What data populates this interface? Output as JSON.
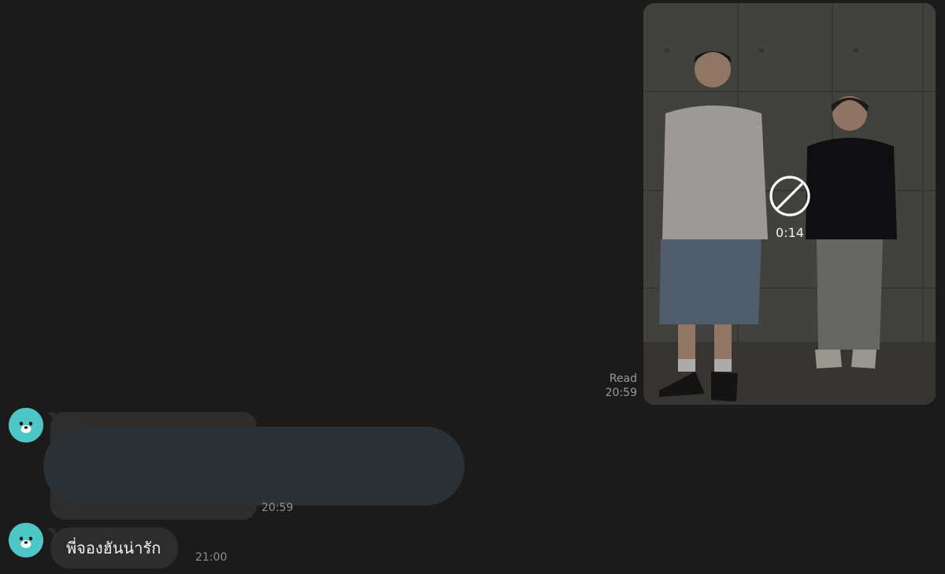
{
  "outgoing": {
    "video": {
      "duration": "0:14",
      "status_icon": "blocked-icon",
      "watermark_icon": "tiktok-logo"
    },
    "status": "Read",
    "time": "20:59"
  },
  "incoming": [
    {
      "avatar_icon": "seal-avatar-icon",
      "text": "",
      "time": "20:59",
      "redacted": true
    },
    {
      "avatar_icon": "seal-avatar-icon",
      "text": "พี่จองฮันน่ารัก",
      "time": "21:00"
    }
  ],
  "colors": {
    "background": "#1b1b1b",
    "bubble": "#2d2d2d",
    "avatar": "#4ec6c6",
    "redaction": "#2b3135"
  }
}
